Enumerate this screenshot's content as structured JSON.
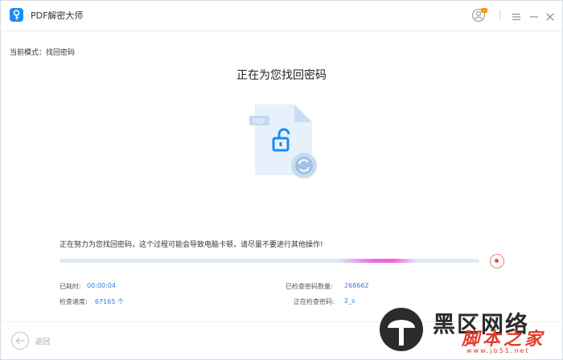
{
  "window": {
    "title": "PDF解密大师"
  },
  "mode": {
    "label": "当前模式：找回密码"
  },
  "main": {
    "title": "正在为您找回密码",
    "badge_text": "PDF"
  },
  "progress": {
    "message": "正在努力为您找回密码，这个过程可能会导致电脑卡顿，请尽量不要进行其他操作!",
    "glow_start": 0.66,
    "glow_width": 0.19
  },
  "stats": {
    "elapsed_label": "已耗时:",
    "elapsed_value": "00:00:04",
    "speed_label": "检查速度:",
    "speed_value": "67165 个",
    "checked_count_label": "已检查密码数量:",
    "checked_count_value": "268662",
    "checking_label": "正在检查密码:",
    "checking_value": "2_s"
  },
  "footer": {
    "back_label": "返回"
  },
  "watermark": {
    "main": "黑区网络",
    "sub": "脚本之家",
    "url": "www.jb51.net"
  },
  "colors": {
    "accent": "#1d8cf0",
    "value_blue": "#2f7fd8",
    "track": "#dde9f5",
    "glow": "#e66de6",
    "stop": "#e84b4b"
  },
  "icons": [
    "app-logo-icon",
    "user-icon",
    "menu-icon",
    "minimize-icon",
    "close-icon",
    "pdf-lock-icon",
    "refresh-icon",
    "stop-icon",
    "back-arrow-icon"
  ]
}
